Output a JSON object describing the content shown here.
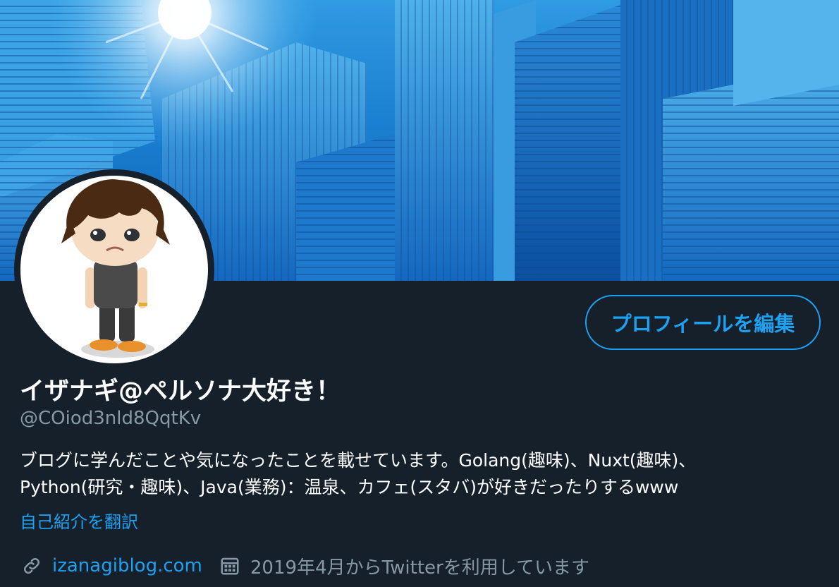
{
  "profile": {
    "display_name": "イザナギ@ペルソナ大好き！",
    "handle": "@COiod3nld8QqtKv",
    "bio_lines": [
      "ブログに学んだことや気になったことを載せています。Golang(趣味)、Nuxt(趣味)、",
      "Python(研究・趣味)、Java(業務)：温泉、カフェ(スタバ)が好きだったりするwww"
    ],
    "translate_label": "自己紹介を翻訳",
    "website": "izanagiblog.com",
    "joined": "2019年4月からTwitterを利用しています"
  },
  "actions": {
    "edit_profile_label": "プロフィールを編集"
  },
  "icons": {
    "link": "link-icon",
    "calendar": "calendar-icon"
  },
  "colors": {
    "background": "#15202b",
    "accent": "#1da1f2",
    "secondary_text": "#8899a6",
    "primary_text": "#ffffff"
  }
}
